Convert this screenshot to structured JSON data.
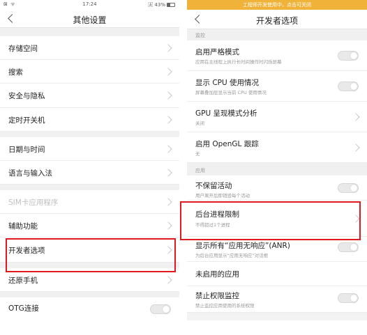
{
  "left": {
    "status": {
      "icons": "⊠ ᯤ",
      "time": "17:24",
      "battery": "🄰 43%"
    },
    "title": "其他设置",
    "rows": [
      {
        "label": "存储空间",
        "type": "chevron"
      },
      {
        "label": "搜索",
        "type": "chevron"
      },
      {
        "label": "安全与隐私",
        "type": "chevron"
      },
      {
        "label": "定时开关机",
        "type": "chevron"
      },
      {
        "label": "日期与时间",
        "type": "chevron"
      },
      {
        "label": "语言与输入法",
        "type": "chevron"
      },
      {
        "label": "SIM卡应用程序",
        "type": "chevron",
        "disabled": true
      },
      {
        "label": "辅助功能",
        "type": "chevron"
      },
      {
        "label": "开发者选项",
        "type": "chevron",
        "highlighted": true
      },
      {
        "label": "还原手机",
        "type": "chevron"
      },
      {
        "label": "OTG连接",
        "type": "toggle",
        "on": false
      }
    ]
  },
  "right": {
    "devbar": "工程师开发使用中，点击可关闭",
    "title": "开发者选项",
    "sections": [
      {
        "header": "监控"
      },
      {
        "header": "应用"
      }
    ],
    "rows": [
      {
        "label": "启用严格模式",
        "sub": "应用在主线程上执行长时间操作时闪烁屏幕",
        "type": "toggle",
        "on": false
      },
      {
        "label": "显示 CPU 使用情况",
        "sub": "屏幕叠加层显示当前 CPU 使用情况",
        "type": "toggle",
        "on": false
      },
      {
        "label": "GPU 呈现模式分析",
        "sub": "关闭",
        "type": "chevron"
      },
      {
        "label": "启用 OpenGL 跟踪",
        "sub": "无",
        "type": "chevron"
      },
      {
        "label": "不保留活动",
        "sub": "用户离开后即销毁每个活动",
        "type": "toggle",
        "on": false
      },
      {
        "label": "后台进程限制",
        "sub": "不得超过1个进程",
        "type": "chevron",
        "highlighted": true
      },
      {
        "label": "显示所有“应用无响应”(ANR)",
        "sub": "为后台应用显示“应用无响应”对话框",
        "type": "toggle",
        "on": false
      },
      {
        "label": "未启用的应用",
        "type": "none"
      },
      {
        "label": "禁止权限监控",
        "sub": "禁止监控应用使用的系统权限",
        "type": "toggle",
        "on": false
      }
    ]
  },
  "colors": {
    "highlight": "#e0191e",
    "devbar": "#f1b23a"
  }
}
